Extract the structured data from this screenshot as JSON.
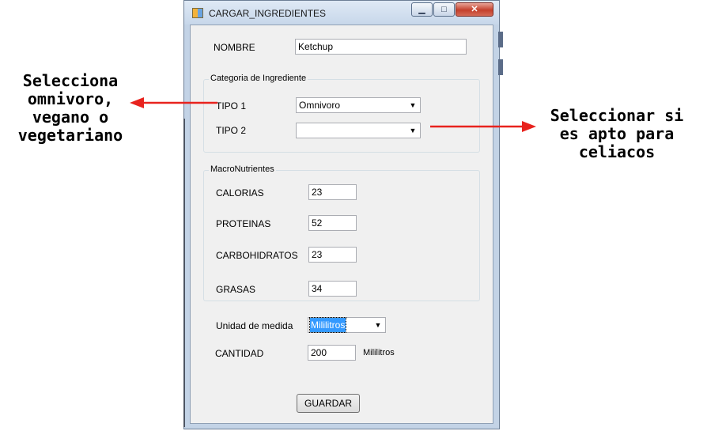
{
  "window": {
    "title": "CARGAR_INGREDIENTES",
    "controls": {
      "minimize": "▁",
      "maximize": "□",
      "close": "✕"
    }
  },
  "form": {
    "nombre_label": "NOMBRE",
    "nombre_value": "Ketchup",
    "categoria_group": "Categoria de Ingrediente",
    "tipo1_label": "TIPO 1",
    "tipo1_value": "Omnivoro",
    "tipo2_label": "TIPO 2",
    "tipo2_value": "",
    "macro_group": "MacroNutrientes",
    "calorias_label": "CALORIAS",
    "calorias_value": "23",
    "proteinas_label": "PROTEINAS",
    "proteinas_value": "52",
    "carbohidratos_label": "CARBOHIDRATOS",
    "carbohidratos_value": "23",
    "grasas_label": "GRASAS",
    "grasas_value": "34",
    "unidad_label": "Unidad de medida",
    "unidad_value": "Mililitros",
    "cantidad_label": "CANTIDAD",
    "cantidad_value": "200",
    "cantidad_unit": "Mililitros",
    "guardar_label": "GUARDAR",
    "dropdown_arrow": "▼"
  },
  "annotations": {
    "left": "Selecciona\nomnivoro,\nvegano o\nvegetariano",
    "right": "Seleccionar si\nes apto para\nceliacos",
    "arrow_color": "#e8231e"
  }
}
